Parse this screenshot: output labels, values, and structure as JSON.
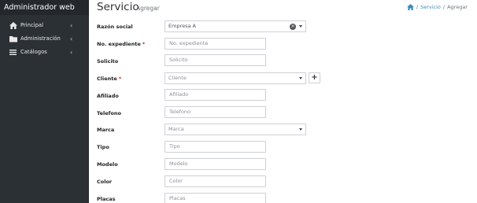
{
  "app": {
    "brand": "Administrador web"
  },
  "sidebar": {
    "items": [
      {
        "label": "Principal",
        "icon": "home-icon"
      },
      {
        "label": "Administración",
        "icon": "folder-icon"
      },
      {
        "label": "Catálogos",
        "icon": "list-icon"
      }
    ],
    "chevron": "‹"
  },
  "page": {
    "title": "Servicio",
    "subtitle": "Agregar"
  },
  "breadcrumb": {
    "sep": "/",
    "items": [
      "Servicio",
      "Agregar"
    ]
  },
  "form": {
    "razon_social": {
      "label": "Razón social",
      "value": "Empresa A"
    },
    "expediente": {
      "label": "No. expediente",
      "placeholder": "No. expediente",
      "required": "*"
    },
    "solicito": {
      "label": "Solicito",
      "placeholder": "Solicito"
    },
    "cliente": {
      "label": "Cliente",
      "placeholder": "Cliente",
      "required": "*",
      "add": "+"
    },
    "afiliado": {
      "label": "Afiliado",
      "placeholder": "Afiliado"
    },
    "telefono": {
      "label": "Telefono",
      "placeholder": "Telefono"
    },
    "marca": {
      "label": "Marca",
      "placeholder": "Marca"
    },
    "tipo": {
      "label": "Tipo",
      "placeholder": "Tipo"
    },
    "modelo": {
      "label": "Modelo",
      "placeholder": "Modelo"
    },
    "color": {
      "label": "Color",
      "placeholder": "Color"
    },
    "placas": {
      "label": "Placas",
      "placeholder": "Placas"
    }
  },
  "colors": {
    "sidebar": "#2b3035",
    "brand_bar": "#24282c",
    "link": "#3c8dbc",
    "required": "#dd2222"
  }
}
